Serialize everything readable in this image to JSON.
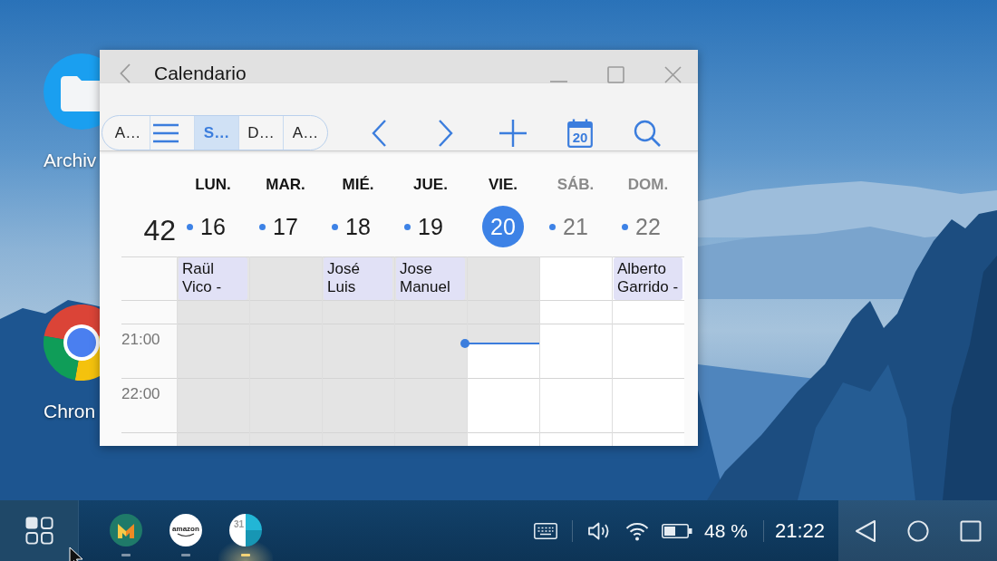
{
  "desktop_icons": [
    {
      "kind": "folder",
      "label": "Archiv"
    },
    {
      "kind": "browser",
      "label": "Chron"
    }
  ],
  "window": {
    "title": "Calendario"
  },
  "view_switcher": [
    {
      "kind": "text",
      "label": "A…",
      "selected": false
    },
    {
      "kind": "menu",
      "selected": false
    },
    {
      "kind": "text",
      "label": "S…",
      "selected": true
    },
    {
      "kind": "text",
      "label": "D…",
      "selected": false
    },
    {
      "kind": "text",
      "label": "A…",
      "selected": false
    }
  ],
  "toolbar": {
    "today_day": "20"
  },
  "week": {
    "number": "42",
    "days": [
      {
        "name": "LUN.",
        "date": "16",
        "dot": true,
        "weekend": false,
        "selected": false,
        "past": true,
        "now_line": false,
        "event": "Raül Vico -"
      },
      {
        "name": "MAR.",
        "date": "17",
        "dot": true,
        "weekend": false,
        "selected": false,
        "past": true,
        "now_line": false
      },
      {
        "name": "MIÉ.",
        "date": "18",
        "dot": true,
        "weekend": false,
        "selected": false,
        "past": true,
        "now_line": false,
        "event": "José Luis"
      },
      {
        "name": "JUE.",
        "date": "19",
        "dot": true,
        "weekend": false,
        "selected": false,
        "past": true,
        "now_line": false,
        "event": "Jose Manuel"
      },
      {
        "name": "VIE.",
        "date": "20",
        "dot": false,
        "weekend": false,
        "selected": true,
        "past": false,
        "now_line": true
      },
      {
        "name": "SÁB.",
        "date": "21",
        "dot": true,
        "weekend": true,
        "selected": false,
        "past": false,
        "now_line": false
      },
      {
        "name": "DOM.",
        "date": "22",
        "dot": true,
        "weekend": true,
        "selected": false,
        "past": false,
        "now_line": false,
        "event": "Alberto Garrido -"
      }
    ]
  },
  "hours": [
    "21:00",
    "22:00"
  ],
  "taskbar": {
    "apps": [
      {
        "kind": "mail",
        "active": false
      },
      {
        "kind": "amazon",
        "label": "amazon",
        "active": false
      },
      {
        "kind": "calendar",
        "label": "31",
        "active": true
      }
    ],
    "tray": {
      "battery": "48 %",
      "clock": "21:22"
    }
  }
}
